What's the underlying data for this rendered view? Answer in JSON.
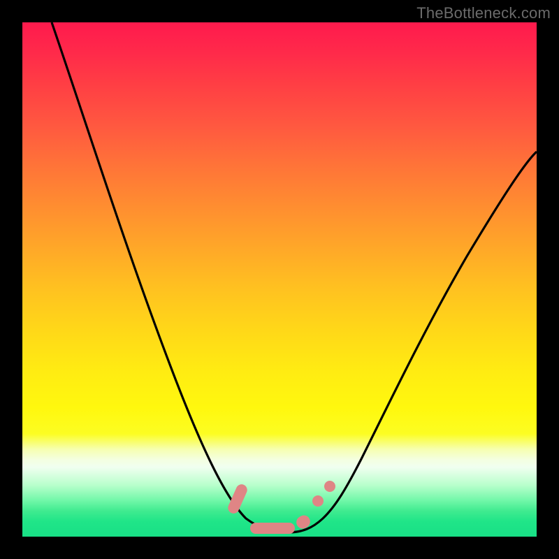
{
  "watermark": "TheBottleneck.com",
  "chart_data": {
    "type": "line",
    "title": "",
    "xlabel": "",
    "ylabel": "",
    "xlim": [
      0,
      100
    ],
    "ylim": [
      0,
      100
    ],
    "grid": false,
    "legend": false,
    "series": [
      {
        "name": "bottleneck-curve",
        "color": "#000000",
        "x": [
          5,
          10,
          15,
          20,
          25,
          30,
          35,
          40,
          42,
          45,
          48,
          50,
          52,
          55,
          58,
          60,
          65,
          70,
          75,
          80,
          85,
          90,
          95,
          100
        ],
        "y": [
          100,
          88,
          76,
          64,
          52,
          40,
          28,
          16,
          10,
          5,
          2,
          1,
          1,
          2,
          4,
          7,
          15,
          24,
          33,
          42,
          50,
          57,
          63,
          68
        ]
      }
    ],
    "markers": {
      "name": "optimum-zone",
      "color": "#e08080",
      "x": [
        42,
        45,
        48,
        50,
        52,
        55,
        57,
        58.5,
        60
      ],
      "y": [
        9,
        4,
        2,
        1,
        1,
        2,
        4,
        6,
        8
      ]
    }
  }
}
